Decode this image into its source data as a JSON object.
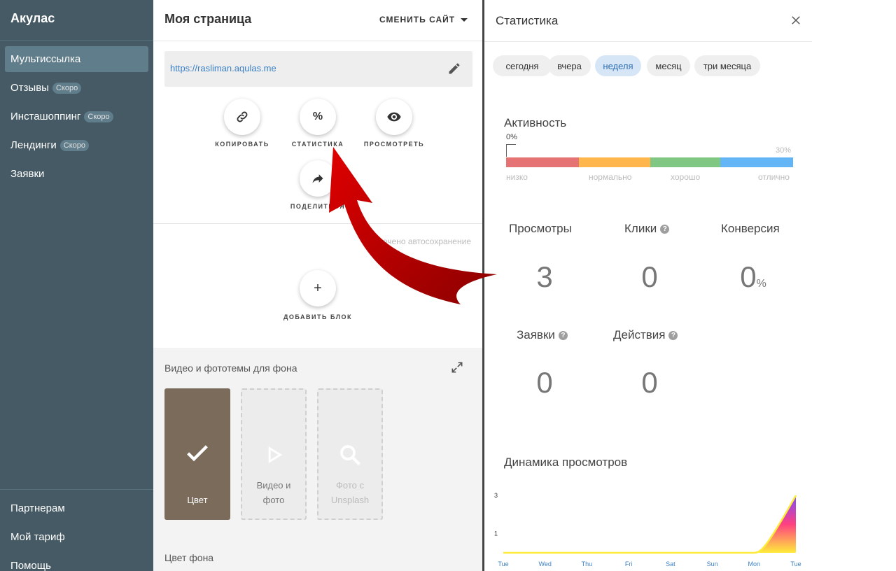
{
  "sidebar": {
    "brand": "Акулас",
    "items": [
      {
        "label": "Мультиссылка",
        "badge": ""
      },
      {
        "label": "Отзывы",
        "badge": "Скоро"
      },
      {
        "label": "Инсташоппинг",
        "badge": "Скоро"
      },
      {
        "label": "Лендинги",
        "badge": "Скоро"
      },
      {
        "label": "Заявки",
        "badge": ""
      }
    ],
    "bottom_items": [
      "Партнерам",
      "Мой тариф",
      "Помощь"
    ]
  },
  "page": {
    "title": "Моя страница",
    "switch_site": "СМЕНИТЬ САЙТ",
    "url": "https://rasliman.aqulas.me",
    "actions": {
      "copy": "КОПИРОВАТЬ",
      "stats": "СТАТИСТИКА",
      "view": "ПРОСМОТРЕТЬ",
      "share": "ПОДЕЛИТЬСЯ"
    },
    "stats_symbol": "%",
    "autosave": "включено автосохранение",
    "add_block": "ДОБАВИТЬ БЛОК",
    "bg_title": "Видео и фототемы для фона",
    "tiles": [
      {
        "label": "Цвет"
      },
      {
        "label_line1": "Видео и",
        "label_line2": "фото"
      },
      {
        "label_line1": "Фото с",
        "label_line2": "Unsplash"
      }
    ],
    "bg_color_label": "Цвет фона"
  },
  "stats": {
    "title": "Статистика",
    "periods": [
      "сегодня",
      "вчера",
      "неделя",
      "месяц",
      "три месяца"
    ],
    "active_period": "неделя",
    "activity": {
      "title": "Активность",
      "min_label": "0%",
      "max_label": "30%",
      "levels": [
        "низко",
        "нормально",
        "хорошо",
        "отлично"
      ],
      "colors": [
        "#e57373",
        "#ffb74d",
        "#81c784",
        "#64b5f6"
      ],
      "value_percent": 0
    },
    "metrics": {
      "views": {
        "label": "Просмотры",
        "value": "3"
      },
      "clicks": {
        "label": "Клики",
        "value": "0"
      },
      "conversion": {
        "label": "Конверсия",
        "value": "0",
        "unit": "%"
      },
      "requests": {
        "label": "Заявки",
        "value": "0"
      },
      "actions": {
        "label": "Действия",
        "value": "0"
      }
    },
    "dynamics_title": "Динамика просмотров"
  },
  "chart_data": {
    "type": "area",
    "title": "Динамика просмотров",
    "categories": [
      "Tue",
      "Wed",
      "Thu",
      "Fri",
      "Sat",
      "Sun",
      "Mon",
      "Tue"
    ],
    "values": [
      0,
      0,
      0,
      0,
      0,
      0,
      0,
      3
    ],
    "y_ticks": [
      "1",
      "3"
    ],
    "ylim": [
      0,
      3
    ],
    "line_color": "#ffeb3b",
    "fill_gradient": [
      "#ffeb3b",
      "#ff4081",
      "#7c4dff"
    ]
  },
  "colors": {
    "sidebar_bg": "#455a64",
    "link": "#3b7fc4",
    "annotation_arrow": "#c00000"
  }
}
